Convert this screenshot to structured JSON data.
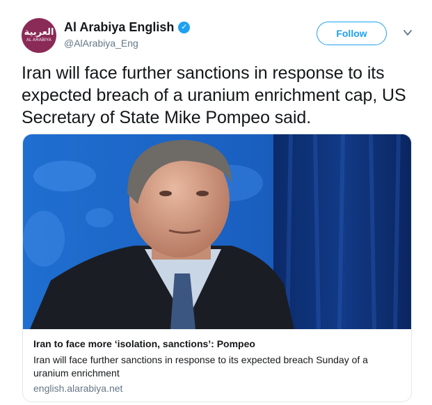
{
  "account": {
    "avatar_arabic": "العربية",
    "avatar_english": "AL ARABIYA",
    "name": "Al Arabiya English",
    "handle": "@AlArabiya_Eng",
    "verified": true
  },
  "actions": {
    "follow_label": "Follow",
    "more_icon": "chevron-down-icon"
  },
  "tweet": {
    "text": "Iran will face further sanctions in response to its expected breach of a uranium enrichment cap, US Secretary of State Mike Pompeo said."
  },
  "card": {
    "image_subject": "photo-of-man-at-podium",
    "title": "Iran to face more ‘isolation, sanctions’: Pompeo",
    "description": "Iran will face further sanctions in response to its expected breach Sunday of a uranium enrichment",
    "domain": "english.alarabiya.net"
  },
  "colors": {
    "brand_blue": "#1da1f2",
    "avatar_bg": "#8a2a57",
    "text_primary": "#14171a",
    "text_secondary": "#657786",
    "card_border": "#e1e8ed"
  }
}
